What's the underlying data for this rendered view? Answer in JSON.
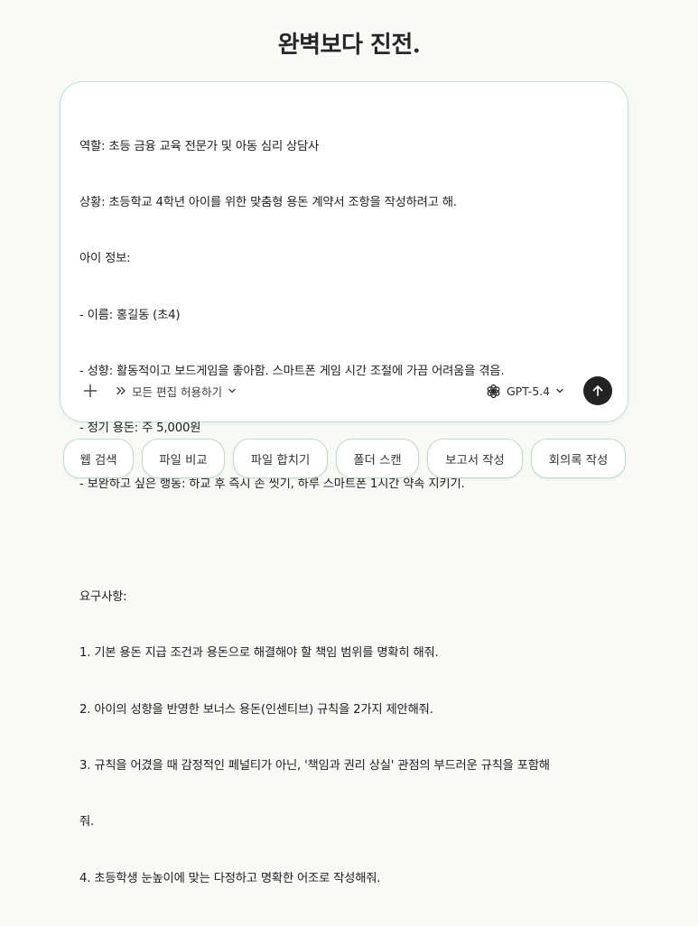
{
  "headline": "완벽보다 진전.",
  "composer": {
    "prompt_lines": [
      "역할: 초등 금융 교육 전문가 및 아동 심리 상담사",
      "상황: 초등학교 4학년 아이를 위한 맞춤형 용돈 계약서 조항을 작성하려고 해.",
      "아이 정보:",
      "- 이름: 홍길동 (초4)",
      "- 성향: 활동적이고 보드게임을 좋아함. 스마트폰 게임 시간 조절에 가끔 어려움을 겪음.",
      "- 정기 용돈: 주 5,000원",
      "- 보완하고 싶은 행동: 하교 후 즉시 손 씻기, 하루 스마트폰 1시간 약속 지키기.",
      "",
      "요구사항:",
      "1. 기본 용돈 지급 조건과 용돈으로 해결해야 할 책임 범위를 명확히 해줘.",
      "2. 아이의 성향을 반영한 보너스 용돈(인센티브) 규칙을 2가지 제안해줘.",
      "3. 규칙을 어겼을 때 감정적인 페널티가 아닌, '책임과 권리 상실' 관점의 부드러운 규칙을 포함해",
      "줘.",
      "4. 초등학생 눈높이에 맞는 다정하고 명확한 어조로 작성해줘."
    ],
    "toolbar": {
      "add_icon": "plus-icon",
      "mode_icon": "double-chevron-right-icon",
      "mode_label": "모든 편집 허용하기",
      "model_icon": "openai-logo-icon",
      "model_label": "GPT-5.4",
      "send_icon": "arrow-up-icon"
    }
  },
  "suggestion_chips": [
    "웹 검색",
    "파일 비교",
    "파일 합치기",
    "폴더 스캔",
    "보고서 작성",
    "회의록 작성"
  ],
  "colors": {
    "background": "#f9faf7",
    "composer_border": "#c7ddd2",
    "chip_border": "#c5d7cd",
    "send_button": "#232323"
  }
}
